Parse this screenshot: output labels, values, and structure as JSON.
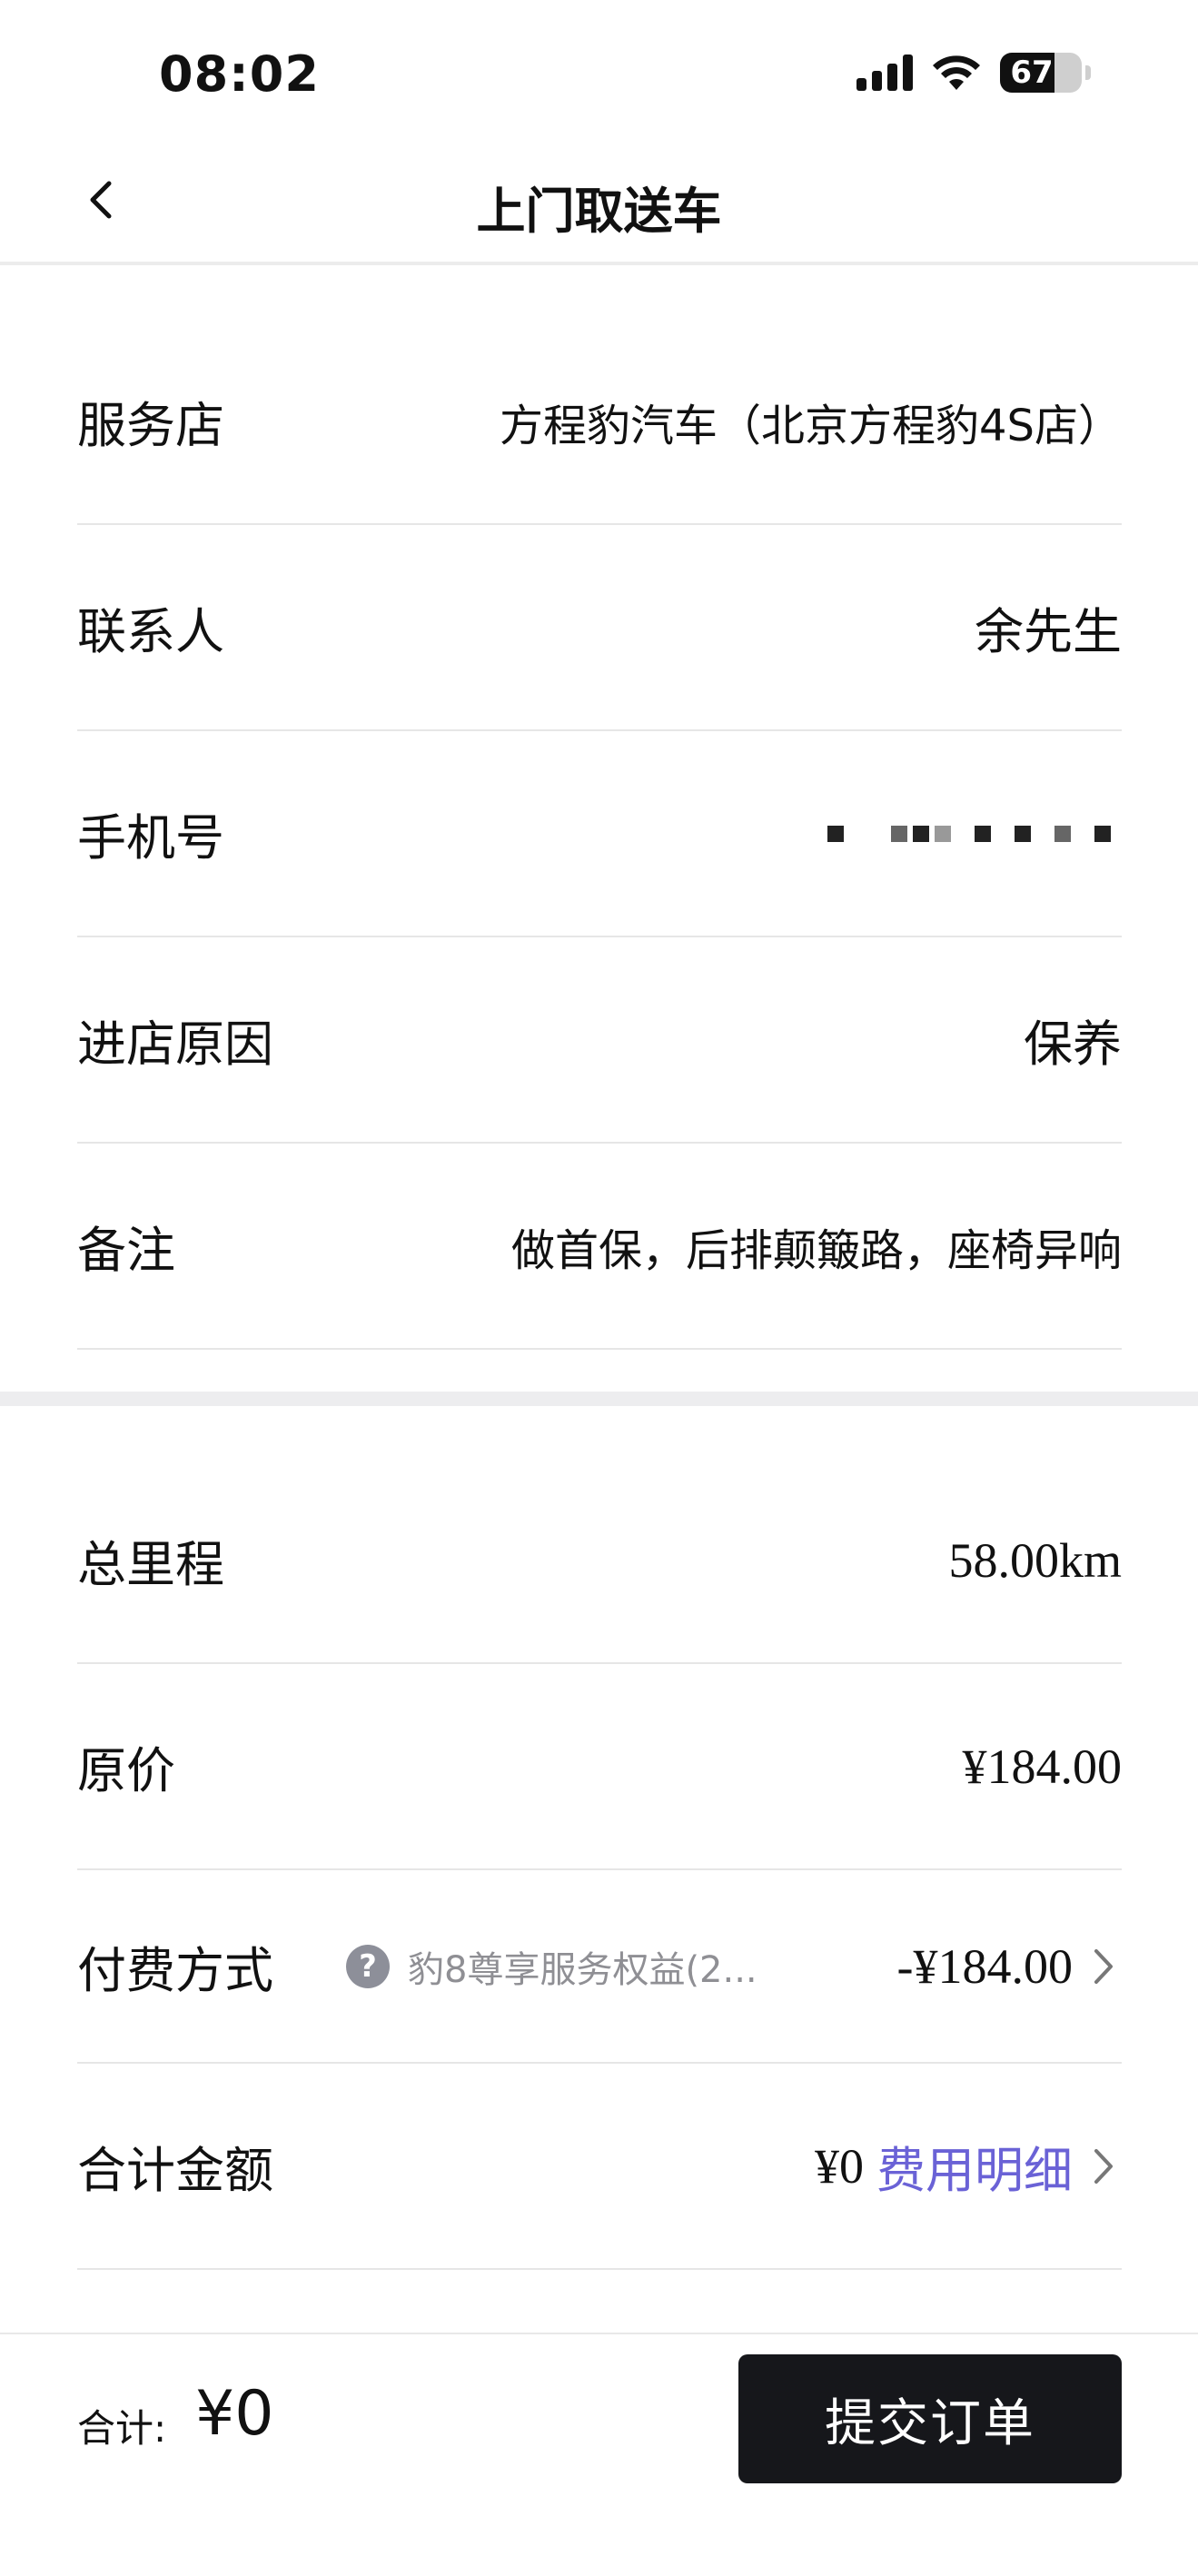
{
  "status_bar": {
    "time": "08:02",
    "battery_text": "67",
    "battery_level": 0.67,
    "icons": [
      "signal-icon",
      "wifi-icon",
      "battery-icon"
    ]
  },
  "nav": {
    "title": "上门取送车",
    "back_icon": "chevron-left-icon"
  },
  "info": {
    "store": {
      "label": "服务店",
      "value": "方程豹汽车（北京方程豹4S店）"
    },
    "contact": {
      "label": "联系人",
      "value": "余先生"
    },
    "phone": {
      "label": "手机号"
    },
    "reason": {
      "label": "进店原因",
      "value": "保养"
    },
    "note": {
      "label": "备注",
      "value": "做首保，后排颠簸路，座椅异响"
    }
  },
  "pricing": {
    "mileage": {
      "label": "总里程",
      "value": "58.00km"
    },
    "original": {
      "label": "原价",
      "value": "¥184.00"
    },
    "payment": {
      "label": "付费方式",
      "help_icon": "?",
      "desc": "豹8尊享服务权益(2...",
      "value": "-¥184.00"
    },
    "total": {
      "label": "合计金额",
      "value": "¥0",
      "link": "费用明细"
    }
  },
  "footer": {
    "total_label": "合计:",
    "total_value": "¥0",
    "submit": "提交订单"
  },
  "colors": {
    "accent": "#6a62d6",
    "button_bg": "#16171b",
    "muted_text": "#8f8f94",
    "divider": "#e6e6e6"
  }
}
